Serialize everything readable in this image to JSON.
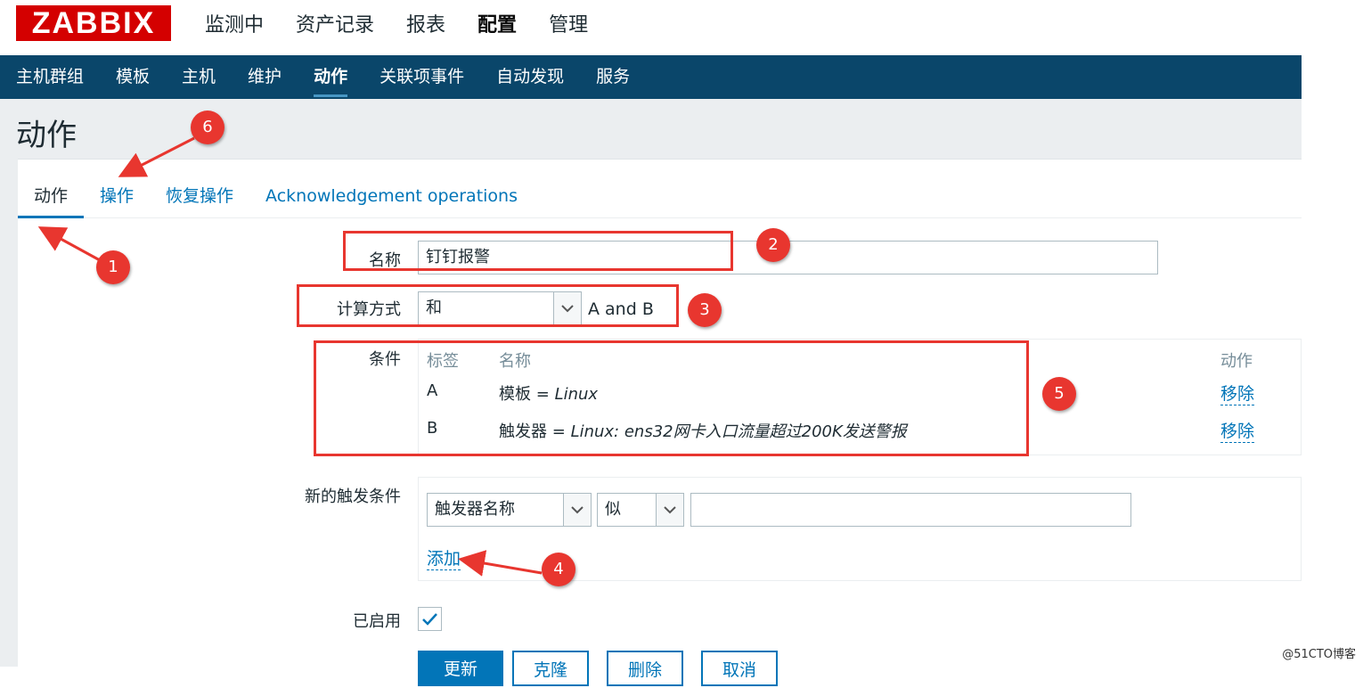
{
  "logo": "ZABBIX",
  "top_menu": [
    "监测中",
    "资产记录",
    "报表",
    "配置",
    "管理"
  ],
  "top_menu_active": "配置",
  "sub_nav": [
    "主机群组",
    "模板",
    "主机",
    "维护",
    "动作",
    "关联项事件",
    "自动发现",
    "服务"
  ],
  "page_title": "动作",
  "tabs": [
    "动作",
    "操作",
    "恢复操作",
    "Acknowledgement operations"
  ],
  "form": {
    "name_label": "名称",
    "name_value": "钉钉报警",
    "calc_label": "计算方式",
    "calc_value": "和",
    "calc_formula": "A and B",
    "conditions_label": "条件",
    "conditions_headers": [
      "标签",
      "名称",
      "动作"
    ],
    "conditions": [
      {
        "tag": "A",
        "field": "模板",
        "op": "=",
        "value": "Linux",
        "action": "移除"
      },
      {
        "tag": "B",
        "field": "触发器",
        "op": "=",
        "value": "Linux: ens32网卡入口流量超过200K发送警报",
        "action": "移除"
      }
    ],
    "new_condition_label": "新的触发条件",
    "new_condition_type": "触发器名称",
    "new_condition_op": "似",
    "new_condition_value": "",
    "add_link": "添加",
    "enabled_label": "已启用",
    "enabled": true
  },
  "buttons": [
    "更新",
    "克隆",
    "删除",
    "取消"
  ],
  "annotations": [
    "1",
    "2",
    "3",
    "4",
    "5",
    "6"
  ],
  "annotation_color": "#e8362f",
  "accent": "#0275b8",
  "nav_bg": "#0a466a",
  "watermark": "@51CTO博客"
}
